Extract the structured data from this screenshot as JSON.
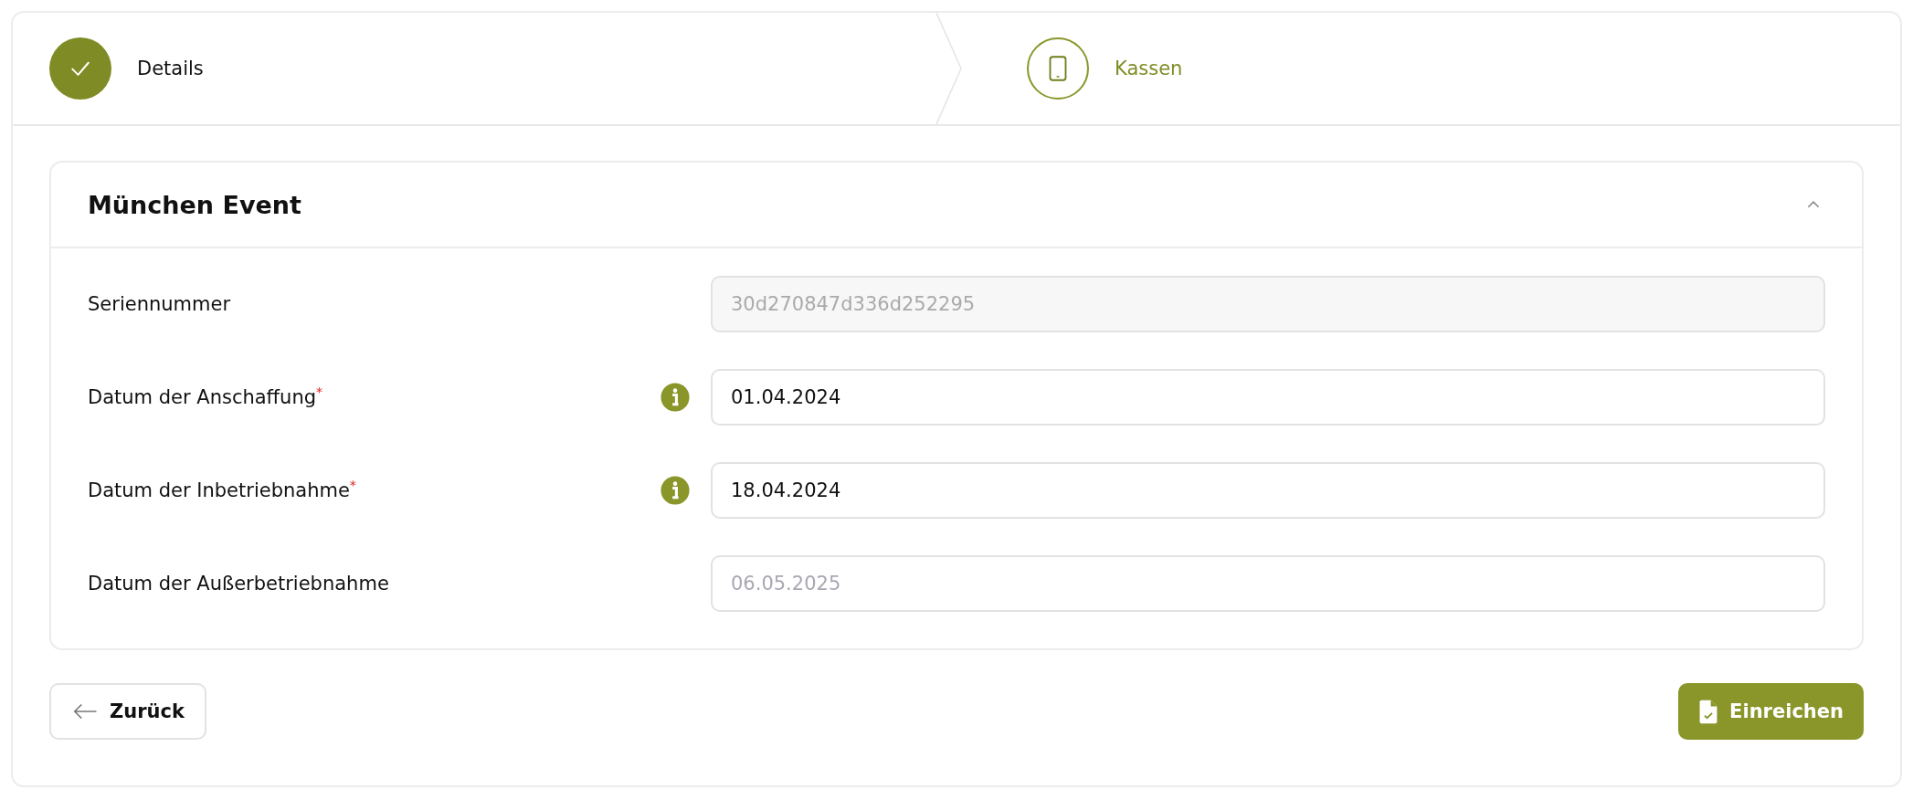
{
  "steps": [
    {
      "label": "Details",
      "completed": true,
      "selected": false
    },
    {
      "label": "Kassen",
      "completed": false,
      "selected": true
    }
  ],
  "section": {
    "title": "München Event",
    "expanded": true,
    "fields": [
      {
        "label": "Seriennummer",
        "info": false,
        "disabled": true,
        "value": "30d270847d336d252295"
      },
      {
        "label": "Datum der Anschaffung",
        "required_mark": "*",
        "info": true,
        "disabled": false,
        "value": "01.04.2024"
      },
      {
        "label": "Datum der Inbetriebnahme",
        "required_mark": "*",
        "info": true,
        "disabled": false,
        "value": "18.04.2024"
      },
      {
        "label": "Datum der Außerbetriebnahme",
        "info": false,
        "disabled": false,
        "placeholder": "06.05.2025"
      }
    ]
  },
  "buttons": {
    "back": "Zurück",
    "submit": "Einreichen"
  }
}
